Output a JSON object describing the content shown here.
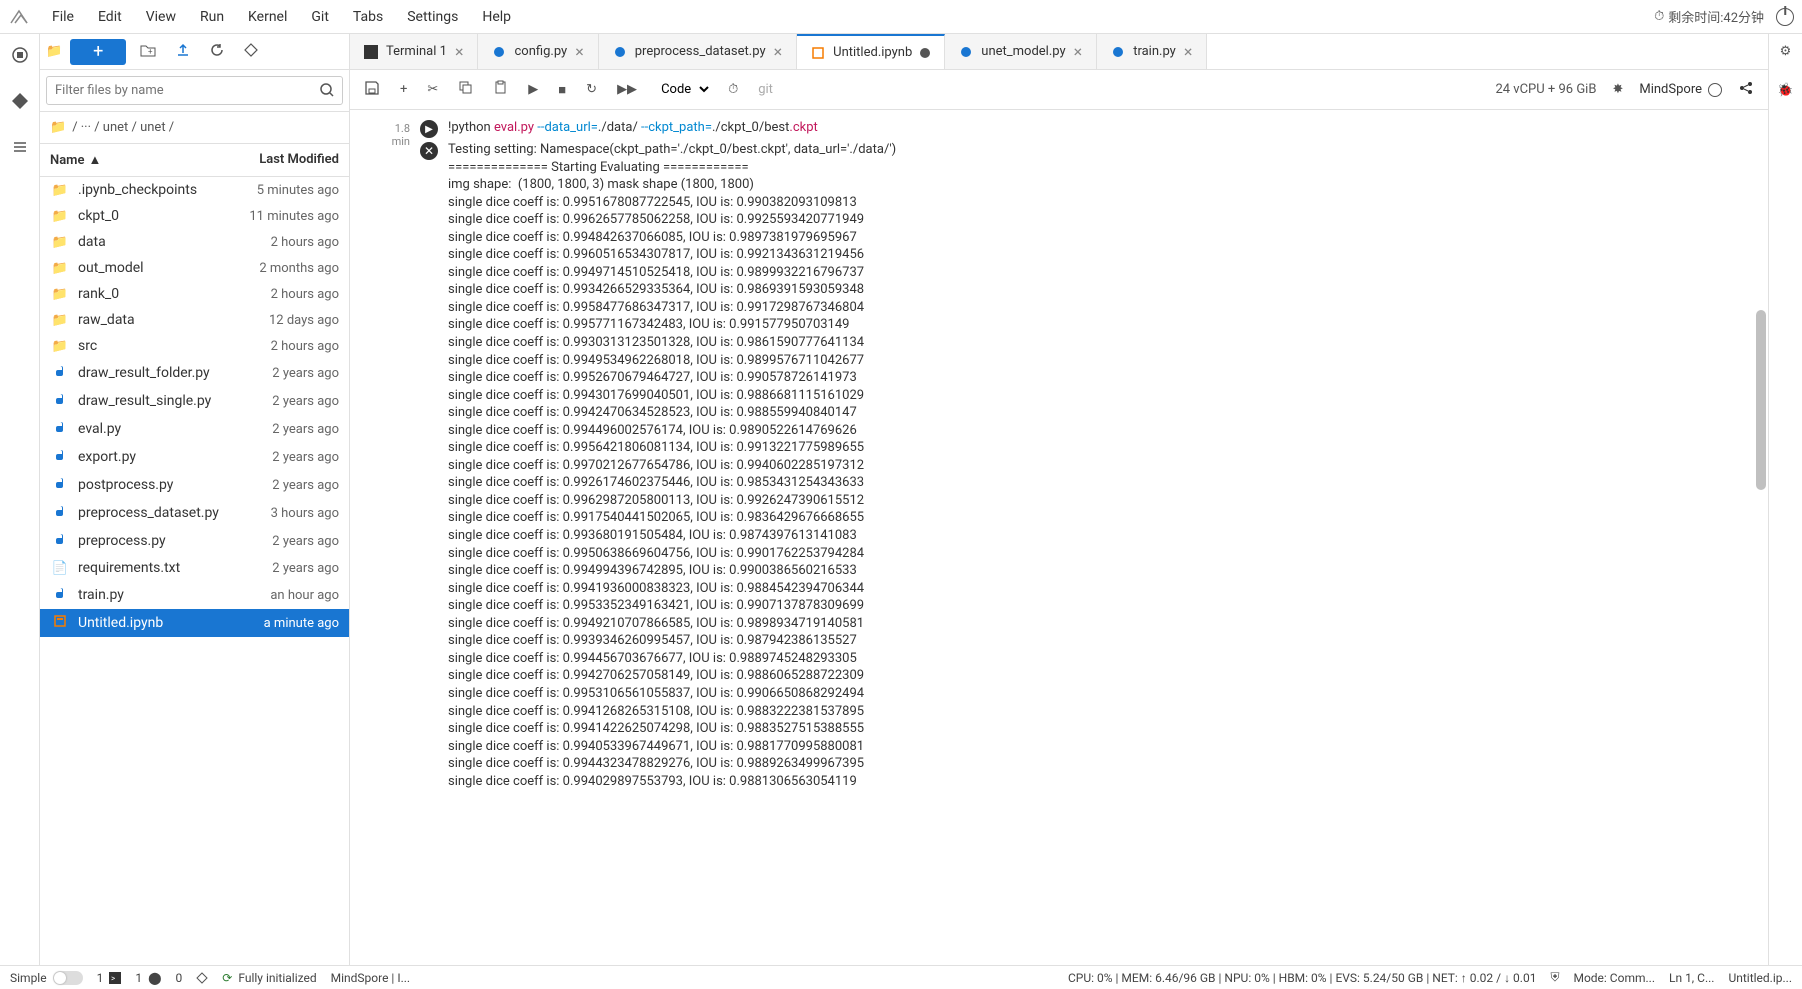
{
  "menubar": {
    "items": [
      "File",
      "Edit",
      "View",
      "Run",
      "Kernel",
      "Git",
      "Tabs",
      "Settings",
      "Help"
    ],
    "time_remaining": "剩余时间:42分钟"
  },
  "filebrowser": {
    "filter_placeholder": "Filter files by name",
    "breadcrumb": "/ ··· / unet / unet /",
    "col_name": "Name",
    "col_modified": "Last Modified",
    "files": [
      {
        "name": ".ipynb_checkpoints",
        "modified": "5 minutes ago",
        "type": "folder"
      },
      {
        "name": "ckpt_0",
        "modified": "11 minutes ago",
        "type": "folder"
      },
      {
        "name": "data",
        "modified": "2 hours ago",
        "type": "folder"
      },
      {
        "name": "out_model",
        "modified": "2 months ago",
        "type": "folder"
      },
      {
        "name": "rank_0",
        "modified": "2 hours ago",
        "type": "folder"
      },
      {
        "name": "raw_data",
        "modified": "12 days ago",
        "type": "folder"
      },
      {
        "name": "src",
        "modified": "2 hours ago",
        "type": "folder"
      },
      {
        "name": "draw_result_folder.py",
        "modified": "2 years ago",
        "type": "py"
      },
      {
        "name": "draw_result_single.py",
        "modified": "2 years ago",
        "type": "py"
      },
      {
        "name": "eval.py",
        "modified": "2 years ago",
        "type": "py"
      },
      {
        "name": "export.py",
        "modified": "2 years ago",
        "type": "py"
      },
      {
        "name": "postprocess.py",
        "modified": "2 years ago",
        "type": "py"
      },
      {
        "name": "preprocess_dataset.py",
        "modified": "3 hours ago",
        "type": "py"
      },
      {
        "name": "preprocess.py",
        "modified": "2 years ago",
        "type": "py"
      },
      {
        "name": "requirements.txt",
        "modified": "2 years ago",
        "type": "txt"
      },
      {
        "name": "train.py",
        "modified": "an hour ago",
        "type": "py"
      },
      {
        "name": "Untitled.ipynb",
        "modified": "a minute ago",
        "type": "nb",
        "selected": true
      }
    ]
  },
  "tabs": [
    {
      "label": "Terminal 1",
      "type": "term"
    },
    {
      "label": "config.py",
      "type": "py"
    },
    {
      "label": "preprocess_dataset.py",
      "type": "py"
    },
    {
      "label": "Untitled.ipynb",
      "type": "nb",
      "active": true,
      "dirty": true
    },
    {
      "label": "unet_model.py",
      "type": "py"
    },
    {
      "label": "train.py",
      "type": "py"
    }
  ],
  "toolbar": {
    "celltype": "Code",
    "git_label": "git",
    "resources": "24 vCPU + 96 GiB",
    "kernel": "MindSpore"
  },
  "cell": {
    "exec_time": "1.8\nmin",
    "code_html": "!python <span class='str'>eval.py</span> <span class='op'>--data_url=</span>./data/ <span class='op'>--ckpt_path=</span>./ckpt_0/best<span class='str'>.ckpt</span>",
    "output": "Testing setting: Namespace(ckpt_path='./ckpt_0/best.ckpt', data_url='./data/')\n============== Starting Evaluating ============\nimg shape:  (1800, 1800, 3) mask shape (1800, 1800)\nsingle dice coeff is: 0.9951678087722545, IOU is: 0.990382093109813\nsingle dice coeff is: 0.9962657785062258, IOU is: 0.9925593420771949\nsingle dice coeff is: 0.994842637066085, IOU is: 0.9897381979695967\nsingle dice coeff is: 0.9960516534307817, IOU is: 0.9921343631219456\nsingle dice coeff is: 0.9949714510525418, IOU is: 0.9899932216796737\nsingle dice coeff is: 0.9934266529335364, IOU is: 0.9869391593059348\nsingle dice coeff is: 0.9958477686347317, IOU is: 0.9917298767346804\nsingle dice coeff is: 0.995771167342483, IOU is: 0.991577950703149\nsingle dice coeff is: 0.9930313123501328, IOU is: 0.9861590777641134\nsingle dice coeff is: 0.9949534962268018, IOU is: 0.9899576711042677\nsingle dice coeff is: 0.9952670679464727, IOU is: 0.990578726141973\nsingle dice coeff is: 0.9943017699040501, IOU is: 0.9886681115161029\nsingle dice coeff is: 0.9942470634528523, IOU is: 0.988559940840147\nsingle dice coeff is: 0.994496002576174, IOU is: 0.9890522614769626\nsingle dice coeff is: 0.9956421806081134, IOU is: 0.9913221775989655\nsingle dice coeff is: 0.9970212677654786, IOU is: 0.9940602285197312\nsingle dice coeff is: 0.9926174602375446, IOU is: 0.9853431254343633\nsingle dice coeff is: 0.9962987205800113, IOU is: 0.9926247390615512\nsingle dice coeff is: 0.9917540441502065, IOU is: 0.9836429676668655\nsingle dice coeff is: 0.993680191505484, IOU is: 0.9874397613141083\nsingle dice coeff is: 0.9950638669604756, IOU is: 0.9901762253794284\nsingle dice coeff is: 0.994994396742895, IOU is: 0.9900386560216533\nsingle dice coeff is: 0.9941936000838323, IOU is: 0.9884542394706344\nsingle dice coeff is: 0.9953352349163421, IOU is: 0.9907137878309699\nsingle dice coeff is: 0.9949210707866585, IOU is: 0.9898934719140581\nsingle dice coeff is: 0.9939346260995457, IOU is: 0.987942386135527\nsingle dice coeff is: 0.994456703676677, IOU is: 0.9889745248293305\nsingle dice coeff is: 0.9942706257058149, IOU is: 0.9886065288722309\nsingle dice coeff is: 0.9953106561055837, IOU is: 0.9906650868292494\nsingle dice coeff is: 0.9941268265315108, IOU is: 0.9883222381537895\nsingle dice coeff is: 0.9941422625074298, IOU is: 0.9883527515388555\nsingle dice coeff is: 0.9940533967449671, IOU is: 0.9881770995880081\nsingle dice coeff is: 0.9944323478829276, IOU is: 0.9889263499967395\nsingle dice coeff is: 0.994029897553793, IOU is: 0.9881306563054119"
  },
  "statusbar": {
    "simple": "Simple",
    "counts": [
      "1",
      "1",
      "0"
    ],
    "init": "Fully initialized",
    "kernel": "MindSpore | I...",
    "metrics": "CPU: 0%  |  MEM: 6.46/96 GB  |  NPU: 0%  |  HBM: 0%  |  EVS: 5.24/50 GB  |  NET: ↑ 0.02 / ↓ 0.01",
    "mode": "Mode: Comm...",
    "ln": "Ln 1, C...",
    "file": "Untitled.ip..."
  }
}
